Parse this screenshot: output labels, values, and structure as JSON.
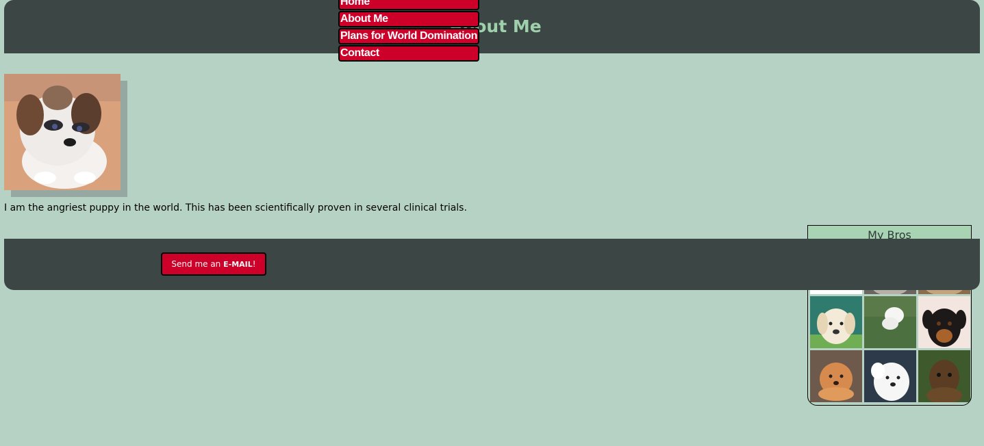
{
  "header": {
    "title": "About Me"
  },
  "nav": {
    "items": [
      {
        "label": "Home"
      },
      {
        "label": "About Me"
      },
      {
        "label": "Plans for World Domination"
      },
      {
        "label": "Contact"
      }
    ]
  },
  "main": {
    "bio": "I am the angriest puppy in the world. This has been scientifically proven in several clinical trials."
  },
  "bros": {
    "title": "My Bros"
  },
  "footer": {
    "email_prefix": "Send me an ",
    "email_strong": "E-MAIL",
    "email_suffix": "!"
  },
  "colors": {
    "background": "#b6d2c4",
    "header": "#3c4645",
    "accent": "#cc0028",
    "title": "#9fd0ac"
  }
}
